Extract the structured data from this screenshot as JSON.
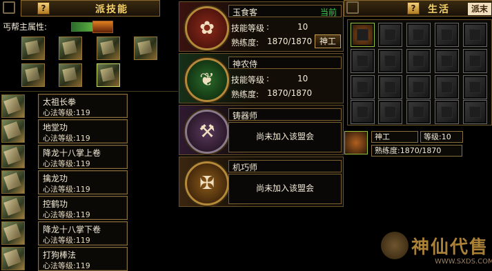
{
  "left_panel": {
    "help_label": "?",
    "title": "派技能",
    "attr_label": "丐帮主属性:",
    "skills": [
      {
        "name": "太祖长拳",
        "level": "心法等级:119"
      },
      {
        "name": "地堂功",
        "level": "心法等级:119"
      },
      {
        "name": "降龙十八掌上卷",
        "level": "心法等级:119"
      },
      {
        "name": "擒龙功",
        "level": "心法等级:119"
      },
      {
        "name": "控鹤功",
        "level": "心法等级:119"
      },
      {
        "name": "降龙十八掌下卷",
        "level": "心法等级:119"
      },
      {
        "name": "打狗棒法",
        "level": "心法等级:119"
      }
    ]
  },
  "professions": [
    {
      "name": "玉食客",
      "status": "当前",
      "skill_level_label": "技能等级",
      "skill_level": "10",
      "proficiency_label": "熟练度:",
      "proficiency": "1870/1870",
      "action": "神工",
      "icon": "chef-emblem-icon"
    },
    {
      "name": "神农侍",
      "skill_level_label": "技能等级",
      "skill_level": "10",
      "proficiency_label": "熟练度:",
      "proficiency": "1870/1870",
      "icon": "herb-emblem-icon"
    },
    {
      "name": "铸器师",
      "message": "尚未加入该盟会",
      "icon": "smith-emblem-icon"
    },
    {
      "name": "机巧师",
      "message": "尚未加入该盟会",
      "icon": "mechanic-emblem-icon"
    }
  ],
  "right_panel": {
    "help_label": "?",
    "title": "生活",
    "tab2": "派末",
    "selected_item": {
      "name": "神工",
      "level_label": "等级:",
      "level": "10",
      "proficiency_label": "熟练度:",
      "proficiency": "1870/1870"
    }
  },
  "watermark": {
    "brand": "神仙代售",
    "url": "WWW.SXDS.COM"
  },
  "colors": {
    "gold": "#f1c24a",
    "accent_green": "#3ad04a",
    "panel_border": "#8a7040"
  }
}
